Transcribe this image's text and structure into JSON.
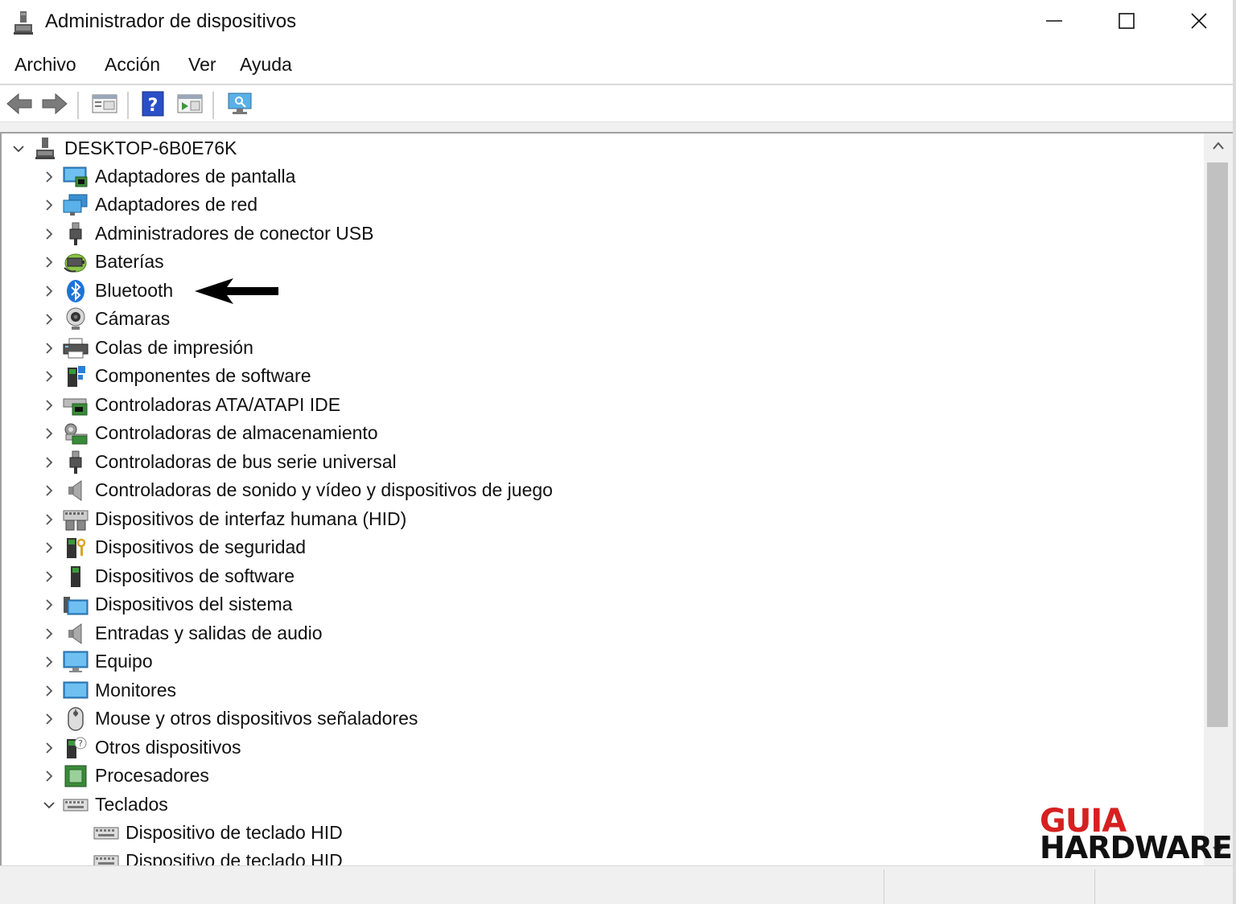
{
  "window": {
    "title": "Administrador de dispositivos",
    "icon": "device-manager-icon"
  },
  "menu": [
    "Archivo",
    "Acción",
    "Ver",
    "Ayuda"
  ],
  "toolbar": {
    "buttons": [
      "back-arrow-icon",
      "forward-arrow-icon",
      "properties-icon",
      "help-icon",
      "update-driver-icon",
      "scan-hardware-icon"
    ]
  },
  "tree": {
    "root": "DESKTOP-6B0E76K",
    "categories": [
      {
        "label": "Adaptadores de pantalla",
        "icon": "display-adapter-icon",
        "expanded": false
      },
      {
        "label": "Adaptadores de red",
        "icon": "network-adapter-icon",
        "expanded": false
      },
      {
        "label": "Administradores de conector USB",
        "icon": "usb-connector-icon",
        "expanded": false
      },
      {
        "label": "Baterías",
        "icon": "battery-icon",
        "expanded": false
      },
      {
        "label": "Bluetooth",
        "icon": "bluetooth-icon",
        "expanded": false
      },
      {
        "label": "Cámaras",
        "icon": "camera-icon",
        "expanded": false
      },
      {
        "label": "Colas de impresión",
        "icon": "printer-icon",
        "expanded": false
      },
      {
        "label": "Componentes de software",
        "icon": "software-component-icon",
        "expanded": false
      },
      {
        "label": "Controladoras ATA/ATAPI IDE",
        "icon": "ide-controller-icon",
        "expanded": false
      },
      {
        "label": "Controladoras de almacenamiento",
        "icon": "storage-controller-icon",
        "expanded": false
      },
      {
        "label": "Controladoras de bus serie universal",
        "icon": "usb-controller-icon",
        "expanded": false
      },
      {
        "label": "Controladoras de sonido y vídeo y dispositivos de juego",
        "icon": "sound-icon",
        "expanded": false
      },
      {
        "label": "Dispositivos de interfaz humana (HID)",
        "icon": "hid-icon",
        "expanded": false
      },
      {
        "label": "Dispositivos de seguridad",
        "icon": "security-device-icon",
        "expanded": false
      },
      {
        "label": "Dispositivos de software",
        "icon": "software-device-icon",
        "expanded": false
      },
      {
        "label": "Dispositivos del sistema",
        "icon": "system-device-icon",
        "expanded": false
      },
      {
        "label": "Entradas y salidas de audio",
        "icon": "audio-io-icon",
        "expanded": false
      },
      {
        "label": "Equipo",
        "icon": "computer-icon",
        "expanded": false
      },
      {
        "label": "Monitores",
        "icon": "monitor-icon",
        "expanded": false
      },
      {
        "label": "Mouse y otros dispositivos señaladores",
        "icon": "mouse-icon",
        "expanded": false
      },
      {
        "label": "Otros dispositivos",
        "icon": "other-device-icon",
        "expanded": false
      },
      {
        "label": "Procesadores",
        "icon": "processor-icon",
        "expanded": false
      },
      {
        "label": "Teclados",
        "icon": "keyboard-icon",
        "expanded": true
      }
    ],
    "keyboard_children": [
      "Dispositivo de teclado HID",
      "Dispositivo de teclado HID"
    ]
  },
  "watermark": {
    "line1": "GUIA",
    "line2": "HARDWARE"
  },
  "colors": {
    "watermark_red": "#d62020",
    "scroll_thumb": "#c1c1c1"
  }
}
